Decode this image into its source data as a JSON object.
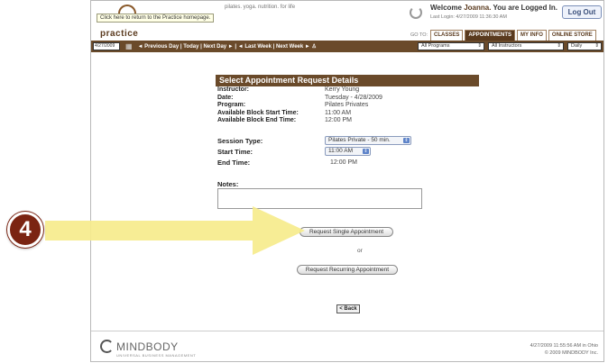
{
  "header": {
    "tooltip": "Click here to return to the Practice homepage.",
    "brand": "practice",
    "tagline": "pilates. yoga. nutrition. for life",
    "welcome_prefix": "Welcome",
    "username": "Joanna.",
    "logged_in_text": "You are Logged In.",
    "last_login": "Last Login: 4/27/2009 11:36:30 AM",
    "logout_label": "Log Out",
    "goto_label": "GO TO:",
    "tabs": [
      "CLASSES",
      "APPOINTMENTS",
      "MY INFO",
      "ONLINE STORE"
    ],
    "active_tab": "APPOINTMENTS"
  },
  "navbar": {
    "date": "4/27/2009",
    "prev_day": "◄ Previous Day",
    "today": "Today",
    "next_day": "Next Day ►",
    "last_week": "◄ Last Week",
    "next_week": "Next Week ►",
    "programs": "All Programs",
    "instructors": "All Instructors",
    "view": "Daily"
  },
  "form": {
    "title": "Select Appointment Request Details",
    "details": [
      {
        "label": "Instructor:",
        "value": "Kerry Young"
      },
      {
        "label": "Date:",
        "value": "Tuesday - 4/28/2009"
      },
      {
        "label": "Program:",
        "value": "Pilates Privates"
      },
      {
        "label": "Available Block Start Time:",
        "value": "11:00 AM"
      },
      {
        "label": "Available Block End Time:",
        "value": "12:00 PM"
      }
    ],
    "session_type_label": "Session Type:",
    "session_type_value": "Pilates Private - 50 min.",
    "start_time_label": "Start Time:",
    "start_time_value": "11:00 AM",
    "end_time_label": "End Time:",
    "end_time_value": "12:00 PM",
    "notes_label": "Notes:",
    "request_single": "Request Single Appointment",
    "or": "or",
    "request_recurring": "Request Recurring Appointment",
    "back": "< Back"
  },
  "footer": {
    "logo": "MINDBODY",
    "logo_sub": "UNIVERSAL BUSINESS MANAGEMENT",
    "timestamp": "4/27/2009 11:55:56 AM in Ohio",
    "copyright": "© 2009 MINDBODY Inc."
  },
  "annotation": {
    "step": "4",
    "arrow_color": "#f6ec8c",
    "badge_color": "#7b2412"
  }
}
